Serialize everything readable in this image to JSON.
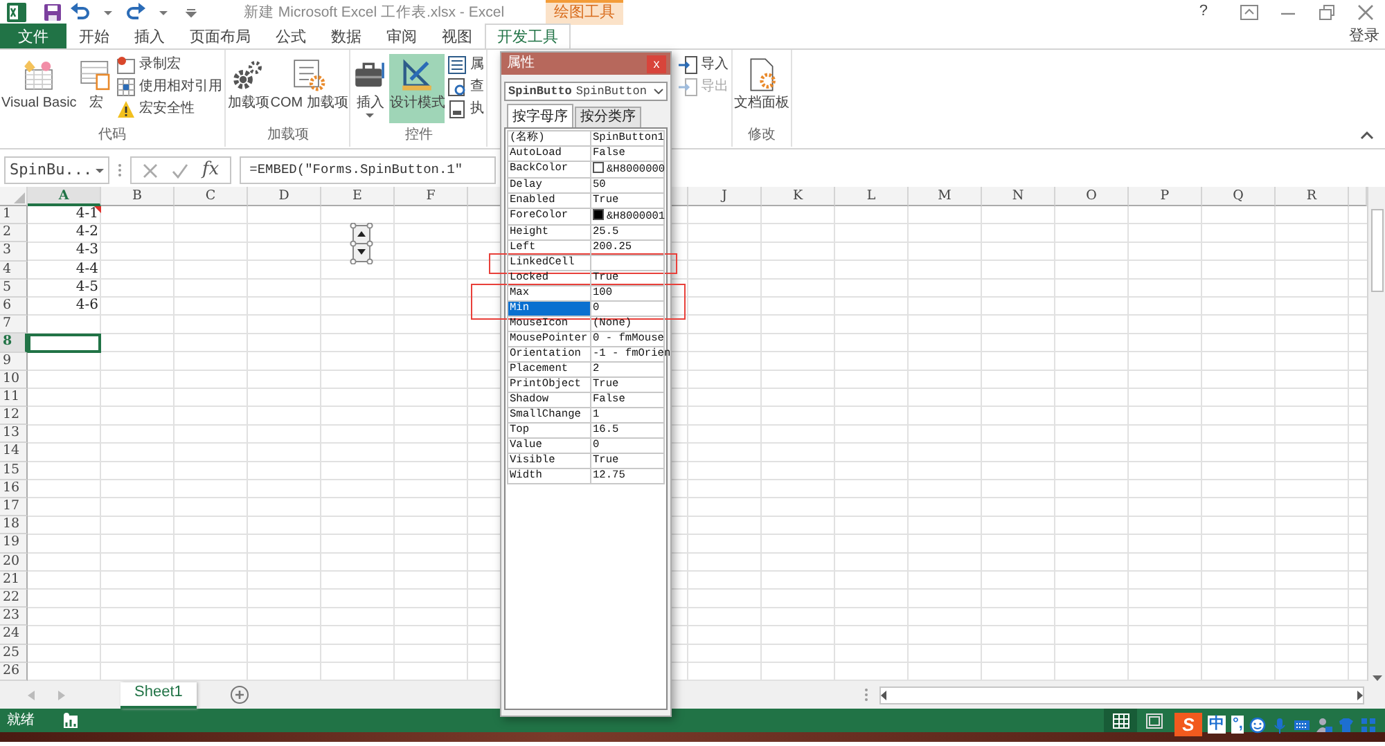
{
  "title_bar": {
    "title": "新建 Microsoft Excel 工作表.xlsx - Excel",
    "context_label": "绘图工具",
    "help": "?"
  },
  "ribbon_tabs": [
    {
      "label": "文件",
      "kind": "file",
      "selected": false
    },
    {
      "label": "开始",
      "kind": "tab",
      "selected": false
    },
    {
      "label": "插入",
      "kind": "tab",
      "selected": false
    },
    {
      "label": "页面布局",
      "kind": "tab",
      "selected": false
    },
    {
      "label": "公式",
      "kind": "tab",
      "selected": false
    },
    {
      "label": "数据",
      "kind": "tab",
      "selected": false
    },
    {
      "label": "审阅",
      "kind": "tab",
      "selected": false
    },
    {
      "label": "视图",
      "kind": "tab",
      "selected": false
    },
    {
      "label": "开发工具",
      "kind": "tab",
      "selected": true
    }
  ],
  "sign_in": "登录",
  "ribbon_groups": [
    {
      "label": "代码",
      "items": [
        {
          "kind": "large",
          "label": "Visual Basic",
          "selected": false,
          "dropdown": false
        },
        {
          "kind": "large",
          "label": "宏",
          "selected": false,
          "dropdown": false
        },
        {
          "kind": "stack",
          "items": [
            {
              "label": "录制宏",
              "disabled": false
            },
            {
              "label": "使用相对引用",
              "disabled": false
            },
            {
              "label": "宏安全性",
              "disabled": false
            }
          ]
        }
      ]
    },
    {
      "label": "加载项",
      "items": [
        {
          "kind": "large",
          "label": "加载项",
          "selected": false,
          "dropdown": false
        },
        {
          "kind": "large",
          "label": "COM 加载项",
          "selected": false,
          "dropdown": false
        }
      ]
    },
    {
      "label": "控件",
      "items": [
        {
          "kind": "large",
          "label": "插入",
          "selected": false,
          "dropdown": true
        },
        {
          "kind": "large",
          "label": "设计模式",
          "selected": true,
          "dropdown": false
        },
        {
          "kind": "stack",
          "items": [
            {
              "label": "属",
              "disabled": false
            },
            {
              "label": "查",
              "disabled": false
            },
            {
              "label": "执",
              "disabled": false
            }
          ]
        }
      ]
    },
    {
      "items": [
        {
          "kind": "stack",
          "items": [
            {
              "label": "导入",
              "disabled": false
            },
            {
              "label": "导出",
              "disabled": true
            }
          ]
        }
      ]
    },
    {
      "label": "修改",
      "items": [
        {
          "kind": "large",
          "label": "文档面板",
          "selected": false,
          "dropdown": false
        }
      ]
    }
  ],
  "formula_bar": {
    "name_box": "SpinBu...",
    "function_label": "fx",
    "formula": "=EMBED(\"Forms.SpinButton.1\""
  },
  "sheet": {
    "columns_left": [
      {
        "label": "A",
        "selected": true
      },
      {
        "label": "B",
        "selected": false
      },
      {
        "label": "C",
        "selected": false
      },
      {
        "label": "D",
        "selected": false
      },
      {
        "label": "E",
        "selected": false
      },
      {
        "label": "F",
        "selected": false
      }
    ],
    "columns_right": [
      {
        "label": "J",
        "selected": false
      },
      {
        "label": "K",
        "selected": false
      },
      {
        "label": "L",
        "selected": false
      },
      {
        "label": "M",
        "selected": false
      },
      {
        "label": "N",
        "selected": false
      },
      {
        "label": "O",
        "selected": false
      },
      {
        "label": "P",
        "selected": false
      },
      {
        "label": "Q",
        "selected": false
      },
      {
        "label": "R",
        "selected": false
      }
    ],
    "rows": [
      {
        "header": "1",
        "selected": false,
        "value": "4-1",
        "comment": true
      },
      {
        "header": "2",
        "selected": false,
        "value": "4-2",
        "comment": false
      },
      {
        "header": "3",
        "selected": false,
        "value": "4-3",
        "comment": false
      },
      {
        "header": "4",
        "selected": false,
        "value": "4-4",
        "comment": false
      },
      {
        "header": "5",
        "selected": false,
        "value": "4-5",
        "comment": false
      },
      {
        "header": "6",
        "selected": false,
        "value": "4-6",
        "comment": false
      },
      {
        "header": "7",
        "selected": false
      },
      {
        "header": "8",
        "selected": true
      },
      {
        "header": "9",
        "selected": false
      },
      {
        "header": "10",
        "selected": false
      },
      {
        "header": "11",
        "selected": false
      },
      {
        "header": "12",
        "selected": false
      },
      {
        "header": "13",
        "selected": false
      },
      {
        "header": "14",
        "selected": false
      },
      {
        "header": "15",
        "selected": false
      },
      {
        "header": "16",
        "selected": false
      },
      {
        "header": "17",
        "selected": false
      },
      {
        "header": "18",
        "selected": false
      },
      {
        "header": "19",
        "selected": false
      },
      {
        "header": "20",
        "selected": false
      },
      {
        "header": "21",
        "selected": false
      },
      {
        "header": "22",
        "selected": false
      },
      {
        "header": "23",
        "selected": false
      },
      {
        "header": "24",
        "selected": false
      },
      {
        "header": "25",
        "selected": false
      },
      {
        "header": "26",
        "selected": false
      }
    ],
    "spin_button": {
      "selected": true
    }
  },
  "sheet_tabs": [
    {
      "label": "Sheet1",
      "selected": true
    }
  ],
  "status_bar": {
    "text": "就绪",
    "views": [
      {
        "selected": true
      },
      {
        "selected": false
      }
    ]
  },
  "ime_toolbar": {
    "logo": "S",
    "mode": "中",
    "punctuation": "°,"
  },
  "properties_window": {
    "title": "属性",
    "close": "x",
    "object_name": "SpinButto",
    "object_type": "SpinButton",
    "tabs": [
      {
        "label": "按字母序",
        "selected": true
      },
      {
        "label": "按分类序",
        "selected": false
      }
    ],
    "rows": [
      {
        "name": "(名称)",
        "value": "SpinButton1",
        "selected": false,
        "marked": false
      },
      {
        "name": "AutoLoad",
        "value": "False",
        "selected": false,
        "marked": false
      },
      {
        "name": "BackColor",
        "value": "&H8000000",
        "color": "#ffffff",
        "selected": false,
        "marked": false
      },
      {
        "name": "Delay",
        "value": "50",
        "selected": false,
        "marked": false
      },
      {
        "name": "Enabled",
        "value": "True",
        "selected": false,
        "marked": false
      },
      {
        "name": "ForeColor",
        "value": "&H8000001",
        "color": "#000000",
        "selected": false,
        "marked": false
      },
      {
        "name": "Height",
        "value": "25.5",
        "selected": false,
        "marked": false
      },
      {
        "name": "Left",
        "value": "200.25",
        "selected": false,
        "marked": false
      },
      {
        "name": "LinkedCell",
        "selected": false,
        "marked": true
      },
      {
        "name": "Locked",
        "value": "True",
        "selected": false,
        "marked": false
      },
      {
        "name": "Max",
        "value": "100",
        "selected": false,
        "marked": true
      },
      {
        "name": "Min",
        "value": "0",
        "selected": true,
        "marked": true
      },
      {
        "name": "MouseIcon",
        "value": "(None)",
        "selected": false,
        "marked": false
      },
      {
        "name": "MousePointer",
        "value": "0 - fmMouse",
        "selected": false,
        "marked": false
      },
      {
        "name": "Orientation",
        "value": "-1 - fmOrien",
        "selected": false,
        "marked": false
      },
      {
        "name": "Placement",
        "value": "2",
        "selected": false,
        "marked": false
      },
      {
        "name": "PrintObject",
        "value": "True",
        "selected": false,
        "marked": false
      },
      {
        "name": "Shadow",
        "value": "False",
        "selected": false,
        "marked": false
      },
      {
        "name": "SmallChange",
        "value": "1",
        "selected": false,
        "marked": false
      },
      {
        "name": "Top",
        "value": "16.5",
        "selected": false,
        "marked": false
      },
      {
        "name": "Value",
        "value": "0",
        "selected": false,
        "marked": false
      },
      {
        "name": "Visible",
        "value": "True",
        "selected": false,
        "marked": false
      },
      {
        "name": "Width",
        "value": "12.75",
        "selected": false,
        "marked": false
      }
    ]
  }
}
